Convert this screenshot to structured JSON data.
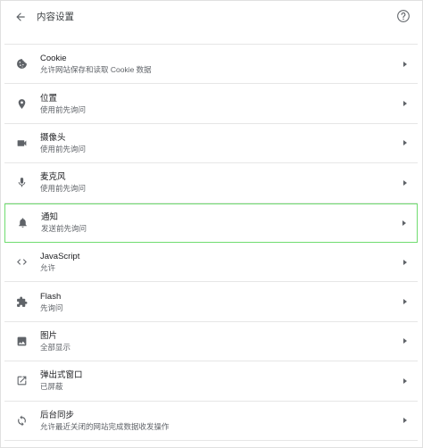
{
  "header": {
    "title": "内容设置"
  },
  "colors": {
    "icon": "#5f6368",
    "highlight_border": "#6fdc6f",
    "divider": "#e6e6e6"
  },
  "items": [
    {
      "label": "Cookie",
      "sub": "允许网站保存和读取 Cookie 数据",
      "icon": "cookie-icon"
    },
    {
      "label": "位置",
      "sub": "使用前先询问",
      "icon": "location-icon"
    },
    {
      "label": "摄像头",
      "sub": "使用前先询问",
      "icon": "camera-icon"
    },
    {
      "label": "麦克风",
      "sub": "使用前先询问",
      "icon": "microphone-icon"
    },
    {
      "label": "通知",
      "sub": "发送前先询问",
      "icon": "bell-icon"
    },
    {
      "label": "JavaScript",
      "sub": "允许",
      "icon": "code-icon"
    },
    {
      "label": "Flash",
      "sub": "先询问",
      "icon": "puzzle-icon"
    },
    {
      "label": "图片",
      "sub": "全部显示",
      "icon": "image-icon"
    },
    {
      "label": "弹出式窗口",
      "sub": "已屏蔽",
      "icon": "open-in-new-icon"
    },
    {
      "label": "后台同步",
      "sub": "允许最近关闭的网站完成数据收发操作",
      "icon": "sync-icon"
    }
  ]
}
